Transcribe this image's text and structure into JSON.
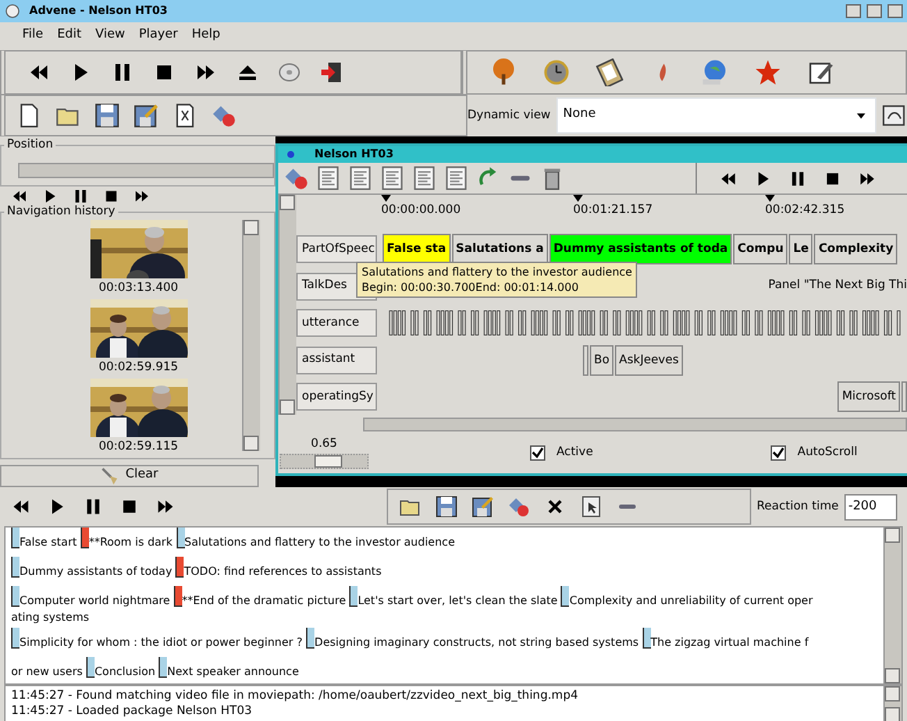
{
  "window": {
    "title": "Advene - Nelson HT03"
  },
  "menu": [
    {
      "label": "File"
    },
    {
      "label": "Edit"
    },
    {
      "label": "View"
    },
    {
      "label": "Player"
    },
    {
      "label": "Help"
    }
  ],
  "dynamic_view": {
    "label": "Dynamic view",
    "value": "None"
  },
  "position": {
    "label": "Position"
  },
  "navigation_history": {
    "label": "Navigation history",
    "items": [
      {
        "time": "00:03:13.400",
        "kind": "picture"
      },
      {
        "time": "00:02:59.915",
        "kind": "picture"
      },
      {
        "time": "00:02:59.115",
        "kind": "picture"
      }
    ],
    "clear_button": "Clear"
  },
  "timeline_window": {
    "title": "Nelson HT03",
    "ticks": [
      "00:00:00.000",
      "00:01:21.157",
      "00:02:42.315"
    ],
    "rows": [
      {
        "type": "PartOfSpeec",
        "kind": "boxes",
        "annotations": [
          {
            "kind": "block",
            "text": "False sta",
            "color": "#ffff00"
          },
          {
            "kind": "block",
            "text": "Salutations a",
            "color": "#dcdad5"
          },
          {
            "kind": "block",
            "text": "Dummy assistants of toda",
            "color": "#00ff00"
          },
          {
            "kind": "block",
            "text": "Compu",
            "color": "#dcdad5"
          },
          {
            "kind": "block",
            "text": "Le",
            "color": "#dcdad5"
          },
          {
            "kind": "block",
            "text": "Complexity",
            "color": "#dcdad5"
          }
        ]
      },
      {
        "type": "TalkDes",
        "kind": "label",
        "annotations": [
          {
            "kind": "block",
            "text": "Panel \"The Next Big Thi"
          }
        ]
      },
      {
        "type": "utterance",
        "kind": "bars"
      },
      {
        "type": "assistant",
        "kind": "boxes",
        "annotations": [
          {
            "kind": "sliver"
          },
          {
            "kind": "block",
            "text": "Bo"
          },
          {
            "kind": "block",
            "text": "AskJeeves"
          }
        ]
      },
      {
        "type": "operatingSy",
        "kind": "boxes",
        "annotations": [
          {
            "kind": "block",
            "text": "Microsoft"
          },
          {
            "kind": "sliver"
          }
        ]
      }
    ],
    "tooltip": [
      "Salutations and flattery to the investor audience",
      "Begin: 00:00:30.700End: 00:01:14.000"
    ],
    "zoom": {
      "reading": "0.65",
      "level": 0.55
    },
    "active": {
      "label": "Active",
      "checked": true
    },
    "autoscroll": {
      "label": "AutoScroll",
      "checked": true
    }
  },
  "reaction_time": {
    "label": "Reaction time",
    "value": "-200"
  },
  "transcript": [
    {
      "items": [
        {
          "kind": "annotation",
          "text": "False start",
          "color": "#a9d3e6"
        },
        {
          "kind": "annotation",
          "text": "**Room is dark",
          "color": "#e84a32"
        },
        {
          "kind": "annotation",
          "text": "Salutations and flattery to the investor audience",
          "color": "#a9d3e6"
        }
      ]
    },
    {
      "items": [
        {
          "kind": "annotation",
          "text": "Dummy assistants of today",
          "color": "#a9d3e6"
        },
        {
          "kind": "annotation",
          "text": "TODO: find references to assistants",
          "color": "#e84a32"
        }
      ]
    },
    {
      "items": [
        {
          "kind": "annotation",
          "text": "Computer world nightmare",
          "color": "#a9d3e6"
        },
        {
          "kind": "annotation",
          "text": "**End of the dramatic picture",
          "color": "#e84a32"
        },
        {
          "kind": "annotation",
          "text": "Let's start over, let's clean the slate",
          "color": "#a9d3e6"
        },
        {
          "kind": "annotation",
          "text": "Complexity and unreliability of current oper",
          "color": "#a9d3e6"
        }
      ]
    },
    {
      "items": [
        {
          "kind": "continuation",
          "text": "ating systems"
        }
      ]
    },
    {
      "items": [
        {
          "kind": "annotation",
          "text": "Simplicity for whom : the idiot or power beginner ?",
          "color": "#a9d3e6"
        },
        {
          "kind": "annotation",
          "text": "Designing imaginary constructs, not string based systems",
          "color": "#a9d3e6"
        },
        {
          "kind": "annotation",
          "text": "The zigzag virtual machine f",
          "color": "#a9d3e6"
        }
      ]
    },
    {
      "items": [
        {
          "kind": "continuation",
          "text": "or new users"
        },
        {
          "kind": "annotation",
          "text": "Conclusion",
          "color": "#a9d3e6"
        },
        {
          "kind": "annotation",
          "text": "Next speaker announce",
          "color": "#a9d3e6"
        }
      ]
    }
  ],
  "log": [
    "11:45:27 - Found matching video file in moviepath: /home/oaubert/zzvideo_next_big_thing.mp4",
    "11:45:27 - Loaded package Nelson HT03"
  ]
}
